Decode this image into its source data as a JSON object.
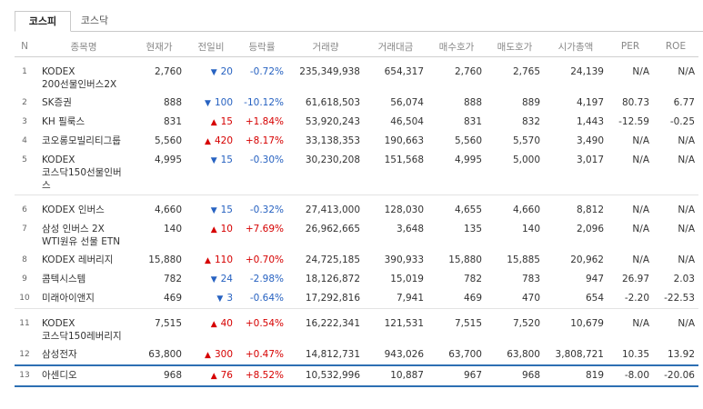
{
  "tabs": [
    {
      "label": "코스피",
      "active": true
    },
    {
      "label": "코스닥",
      "active": false
    }
  ],
  "columns": [
    "N",
    "종목명",
    "현재가",
    "전일비",
    "등락률",
    "거래량",
    "거래대금",
    "매수호가",
    "매도호가",
    "시가총액",
    "PER",
    "ROE"
  ],
  "colors": {
    "up": "#d60000",
    "down": "#2762c1",
    "highlight": "#2d6fb3"
  },
  "groups": [
    [
      {
        "n": "1",
        "name": "KODEX 200선물인버스2X",
        "price": "2,760",
        "dir": "down",
        "change": "20",
        "rate": "-0.72%",
        "volume": "235,349,938",
        "amount": "654,317",
        "bid": "2,760",
        "ask": "2,765",
        "cap": "24,139",
        "per": "N/A",
        "roe": "N/A"
      },
      {
        "n": "2",
        "name": "SK증권",
        "price": "888",
        "dir": "down",
        "change": "100",
        "rate": "-10.12%",
        "volume": "61,618,503",
        "amount": "56,074",
        "bid": "888",
        "ask": "889",
        "cap": "4,197",
        "per": "80.73",
        "roe": "6.77"
      },
      {
        "n": "3",
        "name": "KH 필룩스",
        "price": "831",
        "dir": "up",
        "change": "15",
        "rate": "+1.84%",
        "volume": "53,920,243",
        "amount": "46,504",
        "bid": "831",
        "ask": "832",
        "cap": "1,443",
        "per": "-12.59",
        "roe": "-0.25"
      },
      {
        "n": "4",
        "name": "코오롱모빌리티그룹",
        "price": "5,560",
        "dir": "up",
        "change": "420",
        "rate": "+8.17%",
        "volume": "33,138,353",
        "amount": "190,663",
        "bid": "5,560",
        "ask": "5,570",
        "cap": "3,490",
        "per": "N/A",
        "roe": "N/A"
      },
      {
        "n": "5",
        "name": "KODEX 코스닥150선물인버스",
        "price": "4,995",
        "dir": "down",
        "change": "15",
        "rate": "-0.30%",
        "volume": "30,230,208",
        "amount": "151,568",
        "bid": "4,995",
        "ask": "5,000",
        "cap": "3,017",
        "per": "N/A",
        "roe": "N/A"
      }
    ],
    [
      {
        "n": "6",
        "name": "KODEX 인버스",
        "price": "4,660",
        "dir": "down",
        "change": "15",
        "rate": "-0.32%",
        "volume": "27,413,000",
        "amount": "128,030",
        "bid": "4,655",
        "ask": "4,660",
        "cap": "8,812",
        "per": "N/A",
        "roe": "N/A"
      },
      {
        "n": "7",
        "name": "삼성 인버스 2X WTI원유 선물 ETN",
        "price": "140",
        "dir": "up",
        "change": "10",
        "rate": "+7.69%",
        "volume": "26,962,665",
        "amount": "3,648",
        "bid": "135",
        "ask": "140",
        "cap": "2,096",
        "per": "N/A",
        "roe": "N/A"
      },
      {
        "n": "8",
        "name": "KODEX 레버리지",
        "price": "15,880",
        "dir": "up",
        "change": "110",
        "rate": "+0.70%",
        "volume": "24,725,185",
        "amount": "390,933",
        "bid": "15,880",
        "ask": "15,885",
        "cap": "20,962",
        "per": "N/A",
        "roe": "N/A"
      },
      {
        "n": "9",
        "name": "콤텍시스템",
        "price": "782",
        "dir": "down",
        "change": "24",
        "rate": "-2.98%",
        "volume": "18,126,872",
        "amount": "15,019",
        "bid": "782",
        "ask": "783",
        "cap": "947",
        "per": "26.97",
        "roe": "2.03"
      },
      {
        "n": "10",
        "name": "미래아이앤지",
        "price": "469",
        "dir": "down",
        "change": "3",
        "rate": "-0.64%",
        "volume": "17,292,816",
        "amount": "7,941",
        "bid": "469",
        "ask": "470",
        "cap": "654",
        "per": "-2.20",
        "roe": "-22.53"
      }
    ],
    [
      {
        "n": "11",
        "name": "KODEX 코스닥150레버리지",
        "price": "7,515",
        "dir": "up",
        "change": "40",
        "rate": "+0.54%",
        "volume": "16,222,341",
        "amount": "121,531",
        "bid": "7,515",
        "ask": "7,520",
        "cap": "10,679",
        "per": "N/A",
        "roe": "N/A"
      },
      {
        "n": "12",
        "name": "삼성전자",
        "price": "63,800",
        "dir": "up",
        "change": "300",
        "rate": "+0.47%",
        "volume": "14,812,731",
        "amount": "943,026",
        "bid": "63,700",
        "ask": "63,800",
        "cap": "3,808,721",
        "per": "10.35",
        "roe": "13.92"
      },
      {
        "n": "13",
        "name": "아센디오",
        "price": "968",
        "dir": "up",
        "change": "76",
        "rate": "+8.52%",
        "volume": "10,532,996",
        "amount": "10,887",
        "bid": "967",
        "ask": "968",
        "cap": "819",
        "per": "-8.00",
        "roe": "-20.06",
        "highlighted": true
      }
    ]
  ]
}
